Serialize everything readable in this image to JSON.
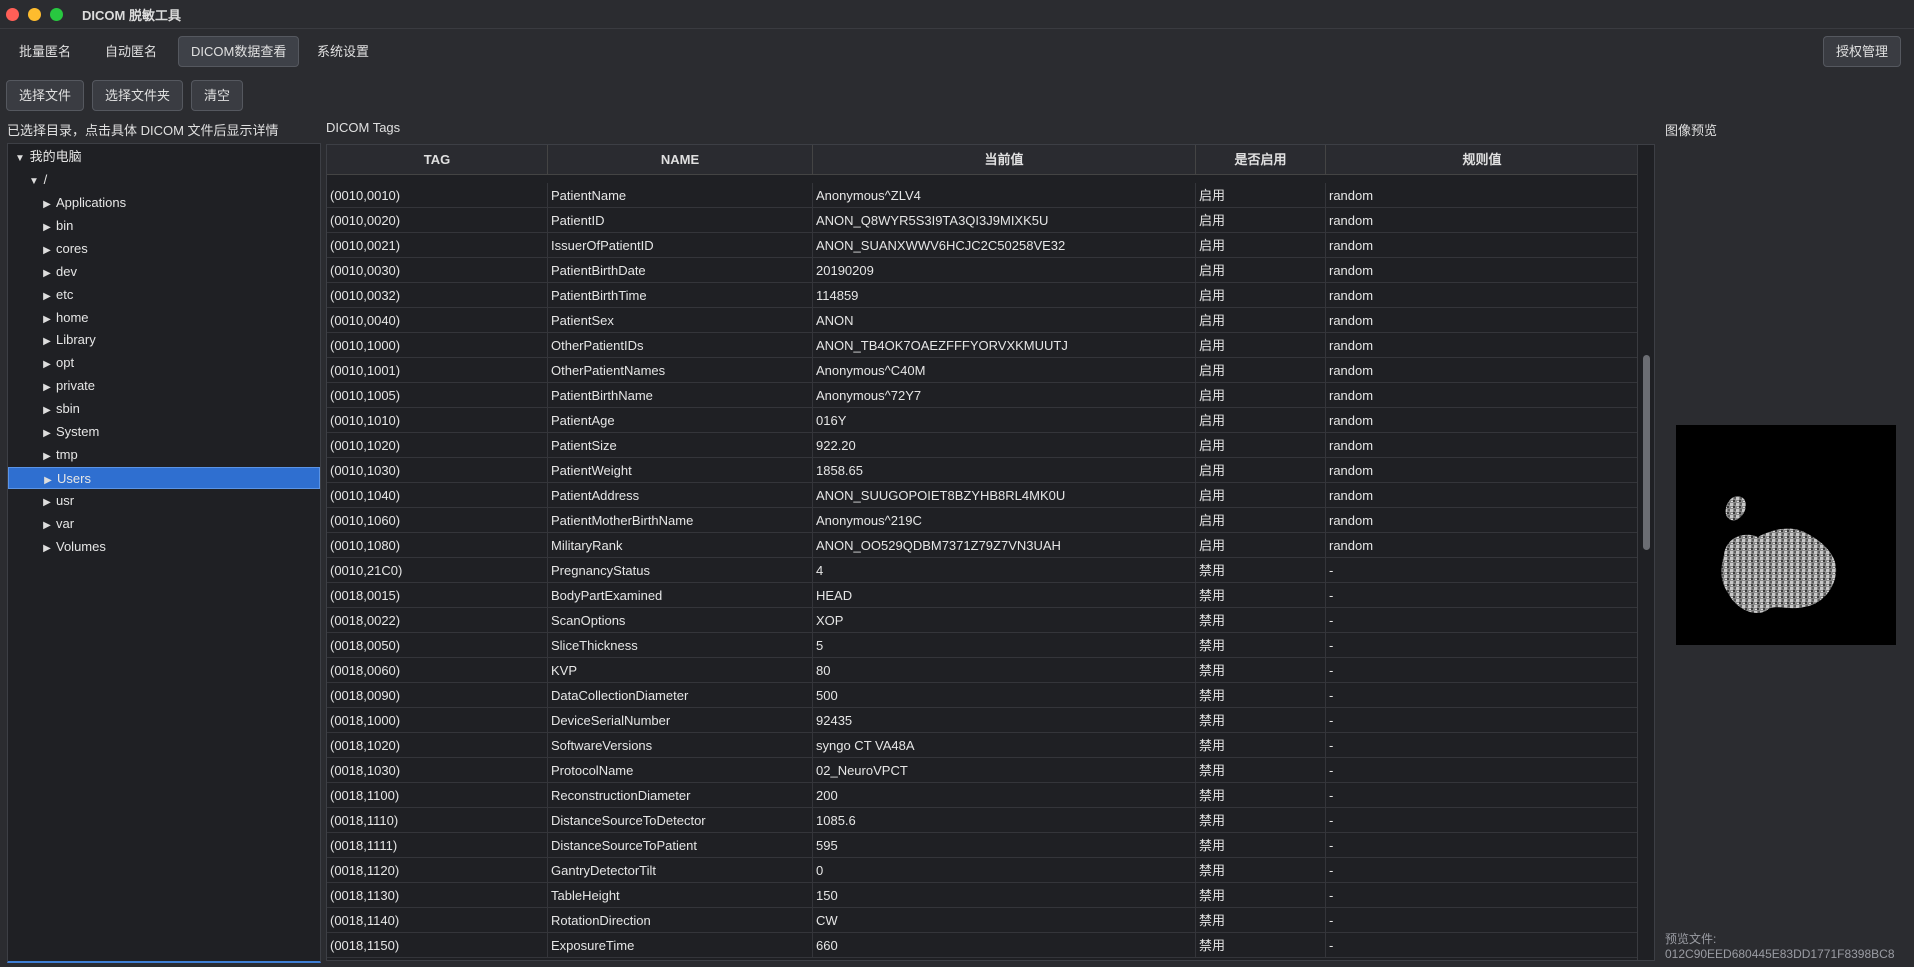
{
  "app": {
    "title": "DICOM 脱敏工具"
  },
  "tabs": [
    {
      "label": "批量匿名"
    },
    {
      "label": "自动匿名"
    },
    {
      "label": "DICOM数据查看"
    },
    {
      "label": "系统设置"
    }
  ],
  "auth_button": "授权管理",
  "toolbar": {
    "select_file": "选择文件",
    "select_folder": "选择文件夹",
    "clear": "清空"
  },
  "left_hint": "已选择目录，点击具体 DICOM 文件后显示详情",
  "tree": {
    "root": "我的电脑",
    "slash": "/",
    "items": [
      "Applications",
      "bin",
      "cores",
      "dev",
      "etc",
      "home",
      "Library",
      "opt",
      "private",
      "sbin",
      "System",
      "tmp",
      "Users",
      "usr",
      "var",
      "Volumes"
    ],
    "selected": "Users"
  },
  "tags_label": "DICOM Tags",
  "table": {
    "headers": [
      "TAG",
      "NAME",
      "当前值",
      "是否启用",
      "规则值"
    ],
    "rows": [
      [
        "(0010,0010)",
        "PatientName",
        "Anonymous^ZLV4",
        "启用",
        "random"
      ],
      [
        "(0010,0020)",
        "PatientID",
        "ANON_Q8WYR5S3I9TA3QI3J9MIXK5U",
        "启用",
        "random"
      ],
      [
        "(0010,0021)",
        "IssuerOfPatientID",
        "ANON_SUANXWWV6HCJC2C50258VE32",
        "启用",
        "random"
      ],
      [
        "(0010,0030)",
        "PatientBirthDate",
        "20190209",
        "启用",
        "random"
      ],
      [
        "(0010,0032)",
        "PatientBirthTime",
        "114859",
        "启用",
        "random"
      ],
      [
        "(0010,0040)",
        "PatientSex",
        "ANON",
        "启用",
        "random"
      ],
      [
        "(0010,1000)",
        "OtherPatientIDs",
        "ANON_TB4OK7OAEZFFFYORVXKMUUTJ",
        "启用",
        "random"
      ],
      [
        "(0010,1001)",
        "OtherPatientNames",
        "Anonymous^C40M",
        "启用",
        "random"
      ],
      [
        "(0010,1005)",
        "PatientBirthName",
        "Anonymous^72Y7",
        "启用",
        "random"
      ],
      [
        "(0010,1010)",
        "PatientAge",
        "016Y",
        "启用",
        "random"
      ],
      [
        "(0010,1020)",
        "PatientSize",
        "922.20",
        "启用",
        "random"
      ],
      [
        "(0010,1030)",
        "PatientWeight",
        "1858.65",
        "启用",
        "random"
      ],
      [
        "(0010,1040)",
        "PatientAddress",
        "ANON_SUUGOPOIET8BZYHB8RL4MK0U",
        "启用",
        "random"
      ],
      [
        "(0010,1060)",
        "PatientMotherBirthName",
        "Anonymous^219C",
        "启用",
        "random"
      ],
      [
        "(0010,1080)",
        "MilitaryRank",
        "ANON_OO529QDBM7371Z79Z7VN3UAH",
        "启用",
        "random"
      ],
      [
        "(0010,21C0)",
        "PregnancyStatus",
        "4",
        "禁用",
        "-"
      ],
      [
        "(0018,0015)",
        "BodyPartExamined",
        "HEAD",
        "禁用",
        "-"
      ],
      [
        "(0018,0022)",
        "ScanOptions",
        "XOP",
        "禁用",
        "-"
      ],
      [
        "(0018,0050)",
        "SliceThickness",
        "5",
        "禁用",
        "-"
      ],
      [
        "(0018,0060)",
        "KVP",
        "80",
        "禁用",
        "-"
      ],
      [
        "(0018,0090)",
        "DataCollectionDiameter",
        "500",
        "禁用",
        "-"
      ],
      [
        "(0018,1000)",
        "DeviceSerialNumber",
        "92435",
        "禁用",
        "-"
      ],
      [
        "(0018,1020)",
        "SoftwareVersions",
        "syngo CT VA48A",
        "禁用",
        "-"
      ],
      [
        "(0018,1030)",
        "ProtocolName",
        "02_NeuroVPCT",
        "禁用",
        "-"
      ],
      [
        "(0018,1100)",
        "ReconstructionDiameter",
        "200",
        "禁用",
        "-"
      ],
      [
        "(0018,1110)",
        "DistanceSourceToDetector",
        "1085.6",
        "禁用",
        "-"
      ],
      [
        "(0018,1111)",
        "DistanceSourceToPatient",
        "595",
        "禁用",
        "-"
      ],
      [
        "(0018,1120)",
        "GantryDetectorTilt",
        "0",
        "禁用",
        "-"
      ],
      [
        "(0018,1130)",
        "TableHeight",
        "150",
        "禁用",
        "-"
      ],
      [
        "(0018,1140)",
        "RotationDirection",
        "CW",
        "禁用",
        "-"
      ],
      [
        "(0018,1150)",
        "ExposureTime",
        "660",
        "禁用",
        "-"
      ]
    ]
  },
  "preview": {
    "label": "图像预览",
    "file_label": "预览文件:",
    "file_name": "012C90EED680445E83DD1771F8398BC8"
  }
}
